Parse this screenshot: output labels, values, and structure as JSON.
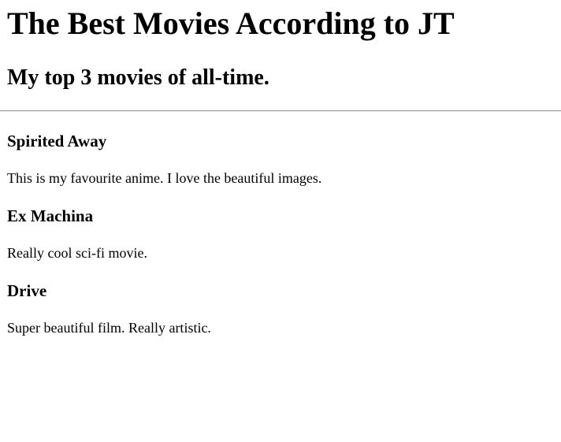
{
  "page": {
    "title": "The Best Movies According to JT",
    "subtitle": "My top 3 movies of all-time."
  },
  "movies": [
    {
      "title": "Spirited Away",
      "description": "This is my favourite anime. I love the beautiful images."
    },
    {
      "title": "Ex Machina",
      "description": "Really cool sci-fi movie."
    },
    {
      "title": "Drive",
      "description": "Super beautiful film. Really artistic."
    }
  ]
}
